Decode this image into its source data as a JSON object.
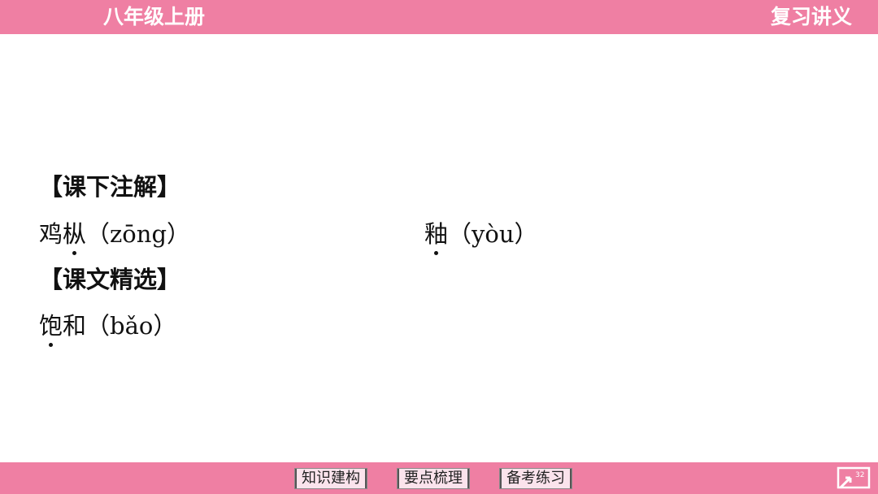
{
  "header": {
    "grade": "八年级上册",
    "series": "复习讲义"
  },
  "sections": [
    {
      "heading": "【课下注解】",
      "entries": [
        {
          "pre": "鸡",
          "dotted": "枞",
          "post": "（zōng）"
        },
        {
          "pre": "",
          "dotted": "釉",
          "post": "（yòu）"
        }
      ]
    },
    {
      "heading": "【课文精选】",
      "entries": [
        {
          "pre": "",
          "dotted": "饱",
          "post": "和（bǎo）"
        }
      ]
    }
  ],
  "footer": {
    "nav": [
      "知识建构",
      "要点梳理",
      "备考练习"
    ],
    "page_number": "32"
  },
  "colors": {
    "bar": "#ef7fa3",
    "button_bg": "#fbe3ec"
  }
}
